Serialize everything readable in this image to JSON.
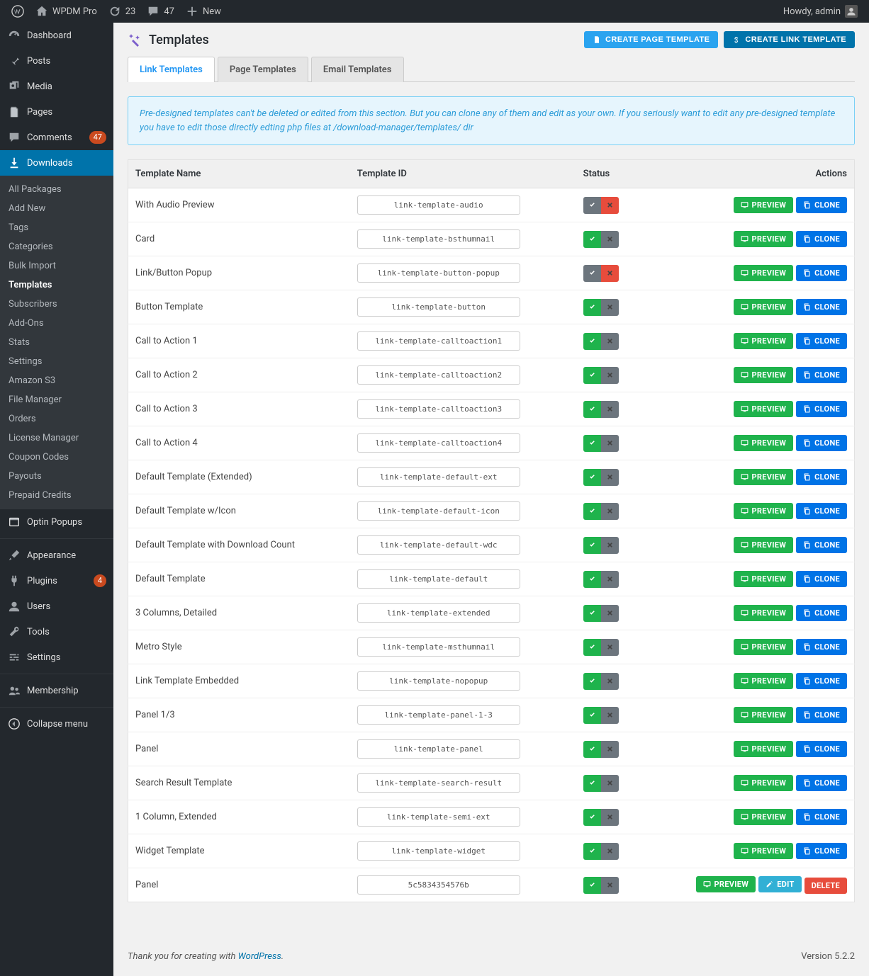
{
  "adminbar": {
    "site": "WPDM Pro",
    "updates": "23",
    "comments": "47",
    "new": "New",
    "howdy": "Howdy, admin"
  },
  "sidebar": {
    "main": [
      {
        "label": "Dashboard",
        "icon": "gauge"
      },
      {
        "label": "Posts",
        "icon": "pin"
      },
      {
        "label": "Media",
        "icon": "media"
      },
      {
        "label": "Pages",
        "icon": "page"
      },
      {
        "label": "Comments",
        "icon": "comment",
        "badge": "47"
      },
      {
        "label": "Downloads",
        "icon": "download",
        "active": true
      }
    ],
    "downloads_sub": [
      "All Packages",
      "Add New",
      "Tags",
      "Categories",
      "Bulk Import",
      "Templates",
      "Subscribers",
      "Add-Ons",
      "Stats",
      "Settings",
      "Amazon S3",
      "File Manager",
      "Orders",
      "License Manager",
      "Coupon Codes",
      "Payouts",
      "Prepaid Credits"
    ],
    "downloads_current": "Templates",
    "after": [
      {
        "label": "Optin Popups",
        "icon": "popup"
      },
      {
        "label": "Appearance",
        "icon": "brush"
      },
      {
        "label": "Plugins",
        "icon": "plug",
        "badge": "4"
      },
      {
        "label": "Users",
        "icon": "user"
      },
      {
        "label": "Tools",
        "icon": "wrench"
      },
      {
        "label": "Settings",
        "icon": "sliders"
      },
      {
        "label": "Membership",
        "icon": "group"
      },
      {
        "label": "Collapse menu",
        "icon": "collapse"
      }
    ]
  },
  "page": {
    "title": "Templates",
    "create_page": "Create Page Template",
    "create_link": "Create Link Template",
    "tabs": [
      "Link Templates",
      "Page Templates",
      "Email Templates"
    ],
    "active_tab": "Link Templates",
    "notice": "Pre-designed templates can't be deleted or edited from this section. But you can clone any of them and edit as your own. If you seriously want to edit any pre-designed template you have to edit those directly edting php files at /download-manager/templates/ dir",
    "columns": {
      "name": "Template Name",
      "id": "Template ID",
      "status": "Status",
      "actions": "Actions"
    },
    "action_labels": {
      "preview": "Preview",
      "clone": "Clone",
      "edit": "Edit",
      "delete": "Delete"
    }
  },
  "rows": [
    {
      "name": "With Audio Preview",
      "id": "link-template-audio",
      "status": "inactive",
      "actions": [
        "preview",
        "clone"
      ]
    },
    {
      "name": "Card",
      "id": "link-template-bsthumnail",
      "status": "active",
      "actions": [
        "preview",
        "clone"
      ]
    },
    {
      "name": "Link/Button Popup",
      "id": "link-template-button-popup",
      "status": "inactive",
      "actions": [
        "preview",
        "clone"
      ]
    },
    {
      "name": "Button Template",
      "id": "link-template-button",
      "status": "active",
      "actions": [
        "preview",
        "clone"
      ]
    },
    {
      "name": "Call to Action 1",
      "id": "link-template-calltoaction1",
      "status": "active",
      "actions": [
        "preview",
        "clone"
      ]
    },
    {
      "name": "Call to Action 2",
      "id": "link-template-calltoaction2",
      "status": "active",
      "actions": [
        "preview",
        "clone"
      ]
    },
    {
      "name": "Call to Action 3",
      "id": "link-template-calltoaction3",
      "status": "active",
      "actions": [
        "preview",
        "clone"
      ]
    },
    {
      "name": "Call to Action 4",
      "id": "link-template-calltoaction4",
      "status": "active",
      "actions": [
        "preview",
        "clone"
      ]
    },
    {
      "name": "Default Template (Extended)",
      "id": "link-template-default-ext",
      "status": "active",
      "actions": [
        "preview",
        "clone"
      ]
    },
    {
      "name": "Default Template w/Icon",
      "id": "link-template-default-icon",
      "status": "active",
      "actions": [
        "preview",
        "clone"
      ]
    },
    {
      "name": "Default Template with Download Count",
      "id": "link-template-default-wdc",
      "status": "active",
      "actions": [
        "preview",
        "clone"
      ]
    },
    {
      "name": "Default Template",
      "id": "link-template-default",
      "status": "active",
      "actions": [
        "preview",
        "clone"
      ]
    },
    {
      "name": "3 Columns, Detailed",
      "id": "link-template-extended",
      "status": "active",
      "actions": [
        "preview",
        "clone"
      ]
    },
    {
      "name": "Metro Style",
      "id": "link-template-msthumnail",
      "status": "active",
      "actions": [
        "preview",
        "clone"
      ]
    },
    {
      "name": "Link Template Embedded",
      "id": "link-template-nopopup",
      "status": "active",
      "actions": [
        "preview",
        "clone"
      ]
    },
    {
      "name": "Panel 1/3",
      "id": "link-template-panel-1-3",
      "status": "active",
      "actions": [
        "preview",
        "clone"
      ]
    },
    {
      "name": "Panel",
      "id": "link-template-panel",
      "status": "active",
      "actions": [
        "preview",
        "clone"
      ]
    },
    {
      "name": "Search Result Template",
      "id": "link-template-search-result",
      "status": "active",
      "actions": [
        "preview",
        "clone"
      ]
    },
    {
      "name": "1 Column, Extended",
      "id": "link-template-semi-ext",
      "status": "active",
      "actions": [
        "preview",
        "clone"
      ]
    },
    {
      "name": "Widget Template",
      "id": "link-template-widget",
      "status": "active",
      "actions": [
        "preview",
        "clone"
      ]
    },
    {
      "name": "Panel",
      "id": "5c5834354576b",
      "status": "active",
      "actions": [
        "preview",
        "edit",
        "delete"
      ]
    }
  ],
  "footer": {
    "thanks_pre": "Thank you for creating with ",
    "wp": "WordPress",
    "thanks_post": ".",
    "version": "Version 5.2.2"
  }
}
